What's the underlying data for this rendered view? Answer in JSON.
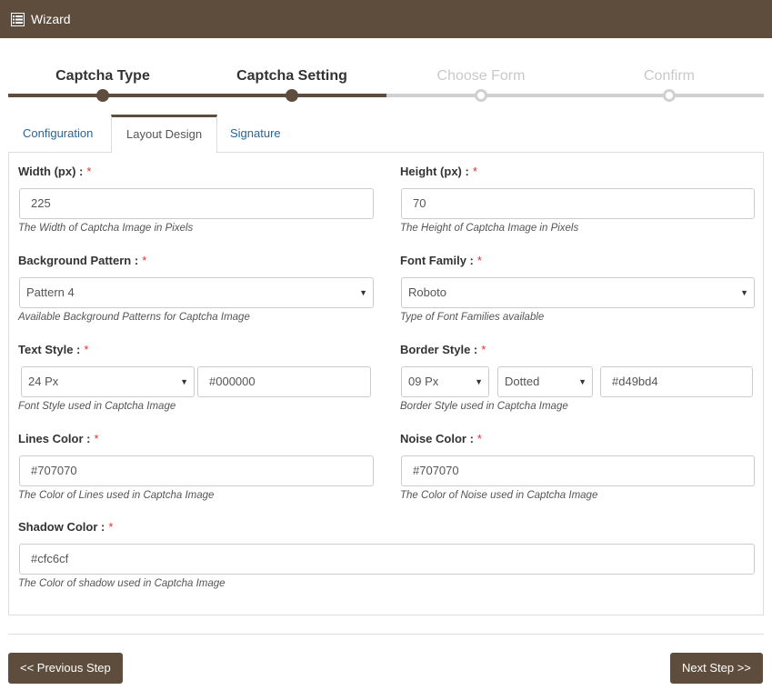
{
  "header": {
    "title": "Wizard",
    "icon": "list-icon"
  },
  "steps": [
    {
      "label": "Captcha Type",
      "state": "done"
    },
    {
      "label": "Captcha Setting",
      "state": "done"
    },
    {
      "label": "Choose Form",
      "state": "todo"
    },
    {
      "label": "Confirm",
      "state": "todo"
    }
  ],
  "tabs": [
    {
      "label": "Configuration"
    },
    {
      "label": "Layout Design"
    },
    {
      "label": "Signature"
    }
  ],
  "form": {
    "width": {
      "label": "Width (px) :",
      "required": "*",
      "value": "225",
      "help": "The Width of Captcha Image in Pixels"
    },
    "height": {
      "label": "Height (px) :",
      "required": "*",
      "value": "70",
      "help": "The Height of Captcha Image in Pixels"
    },
    "background": {
      "label": "Background Pattern :",
      "required": "*",
      "value": "Pattern 4",
      "help": "Available Background Patterns for Captcha Image"
    },
    "font_family": {
      "label": "Font Family :",
      "required": "*",
      "value": "Roboto",
      "help": "Type of Font Families available"
    },
    "text_style": {
      "label": "Text Style :",
      "required": "*",
      "size": "24 Px",
      "color": "#000000",
      "help": "Font Style used in Captcha Image"
    },
    "border_style": {
      "label": "Border Style :",
      "required": "*",
      "size": "09 Px",
      "type": "Dotted",
      "color": "#d49bd4",
      "help": "Border Style used in Captcha Image"
    },
    "lines_color": {
      "label": "Lines Color :",
      "required": "*",
      "value": "#707070",
      "help": "The Color of Lines used in Captcha Image"
    },
    "noise_color": {
      "label": "Noise Color :",
      "required": "*",
      "value": "#707070",
      "help": "The Color of Noise used in Captcha Image"
    },
    "shadow_color": {
      "label": "Shadow Color :",
      "required": "*",
      "value": "#cfc6cf",
      "help": "The Color of shadow used in Captcha Image"
    }
  },
  "buttons": {
    "previous": "<< Previous Step",
    "next": "Next Step >>"
  },
  "colors": {
    "brand": "#5e4d3c",
    "link": "#2a6496",
    "required": "#e03030"
  }
}
